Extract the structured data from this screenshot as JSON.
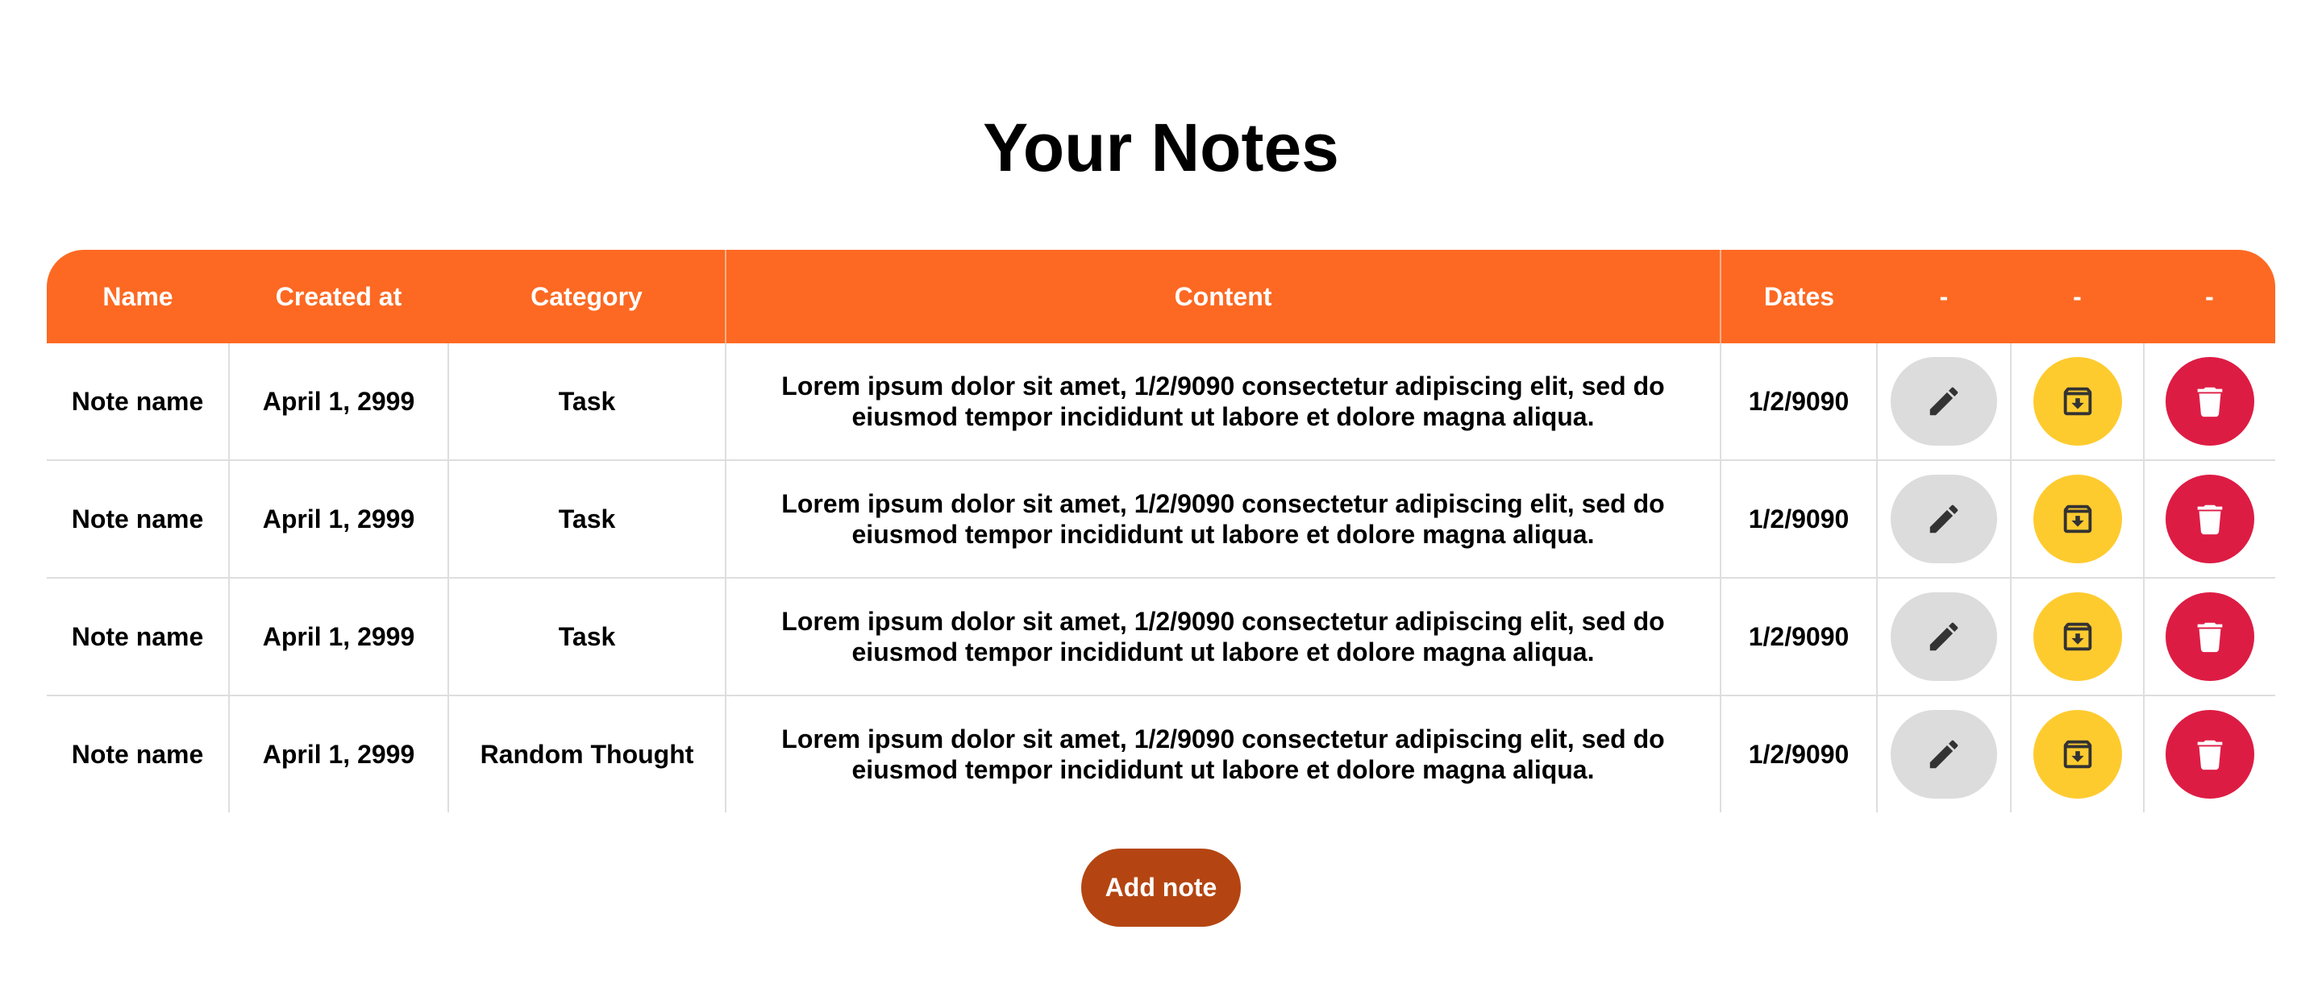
{
  "page": {
    "title": "Your Notes"
  },
  "table": {
    "headers": {
      "name": "Name",
      "created_at": "Created at",
      "category": "Category",
      "content": "Content",
      "dates": "Dates",
      "action_edit": "-",
      "action_archive": "-",
      "action_delete": "-"
    },
    "rows": [
      {
        "name": "Note name",
        "created_at": "April 1, 2999",
        "category": "Task",
        "content": "Lorem ipsum dolor sit amet, 1/2/9090 consectetur adipiscing elit, sed do eiusmod tempor incididunt ut labore et dolore magna aliqua.",
        "dates": "1/2/9090"
      },
      {
        "name": "Note name",
        "created_at": "April 1, 2999",
        "category": "Task",
        "content": "Lorem ipsum dolor sit amet, 1/2/9090 consectetur adipiscing elit, sed do eiusmod tempor incididunt ut labore et dolore magna aliqua.",
        "dates": "1/2/9090"
      },
      {
        "name": "Note name",
        "created_at": "April 1, 2999",
        "category": "Task",
        "content": "Lorem ipsum dolor sit amet, 1/2/9090 consectetur adipiscing elit, sed do eiusmod tempor incididunt ut labore et dolore magna aliqua.",
        "dates": "1/2/9090"
      },
      {
        "name": "Note name",
        "created_at": "April 1, 2999",
        "category": "Random Thought",
        "content": "Lorem ipsum dolor sit amet, 1/2/9090 consectetur adipiscing elit, sed do eiusmod tempor incididunt ut labore et dolore magna aliqua.",
        "dates": "1/2/9090"
      }
    ],
    "row_actions": {
      "edit_icon": "pencil-icon",
      "archive_icon": "archive-icon",
      "delete_icon": "trash-icon"
    }
  },
  "footer": {
    "add_note_label": "Add note"
  },
  "colors": {
    "header_bg": "#fd6922",
    "edit_button": "#dcdcdc",
    "archive_button": "#fecb2f",
    "delete_button": "#dd1c44",
    "add_note_button": "#b44512"
  }
}
